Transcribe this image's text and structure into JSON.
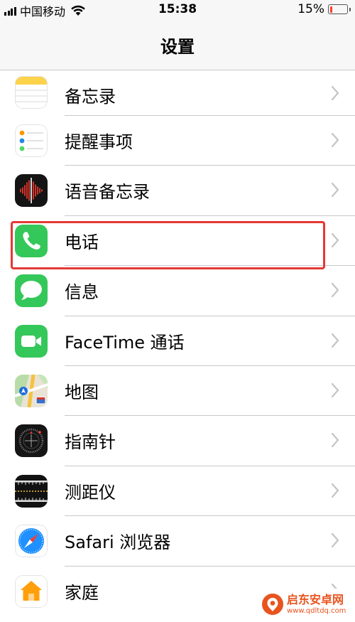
{
  "status": {
    "carrier": "中国移动",
    "time": "15:38",
    "battery_percent": "15%",
    "battery_level": 0.15
  },
  "nav": {
    "title": "设置"
  },
  "items": [
    {
      "label": "备忘录",
      "icon": "notes-icon"
    },
    {
      "label": "提醒事项",
      "icon": "reminders-icon"
    },
    {
      "label": "语音备忘录",
      "icon": "voice-memos-icon"
    },
    {
      "label": "电话",
      "icon": "phone-icon"
    },
    {
      "label": "信息",
      "icon": "messages-icon"
    },
    {
      "label": "FaceTime 通话",
      "icon": "facetime-icon"
    },
    {
      "label": "地图",
      "icon": "maps-icon"
    },
    {
      "label": "指南针",
      "icon": "compass-icon"
    },
    {
      "label": "测距仪",
      "icon": "measure-icon"
    },
    {
      "label": "Safari 浏览器",
      "icon": "safari-icon"
    },
    {
      "label": "家庭",
      "icon": "home-icon"
    }
  ],
  "colors": {
    "highlight": "#e53935",
    "phone_green": "#34c759",
    "separator": "#c8c7cc",
    "watermark_orange": "#e8541e"
  },
  "watermark": {
    "name": "启东安卓网",
    "url": "www.qdltdq.com"
  }
}
